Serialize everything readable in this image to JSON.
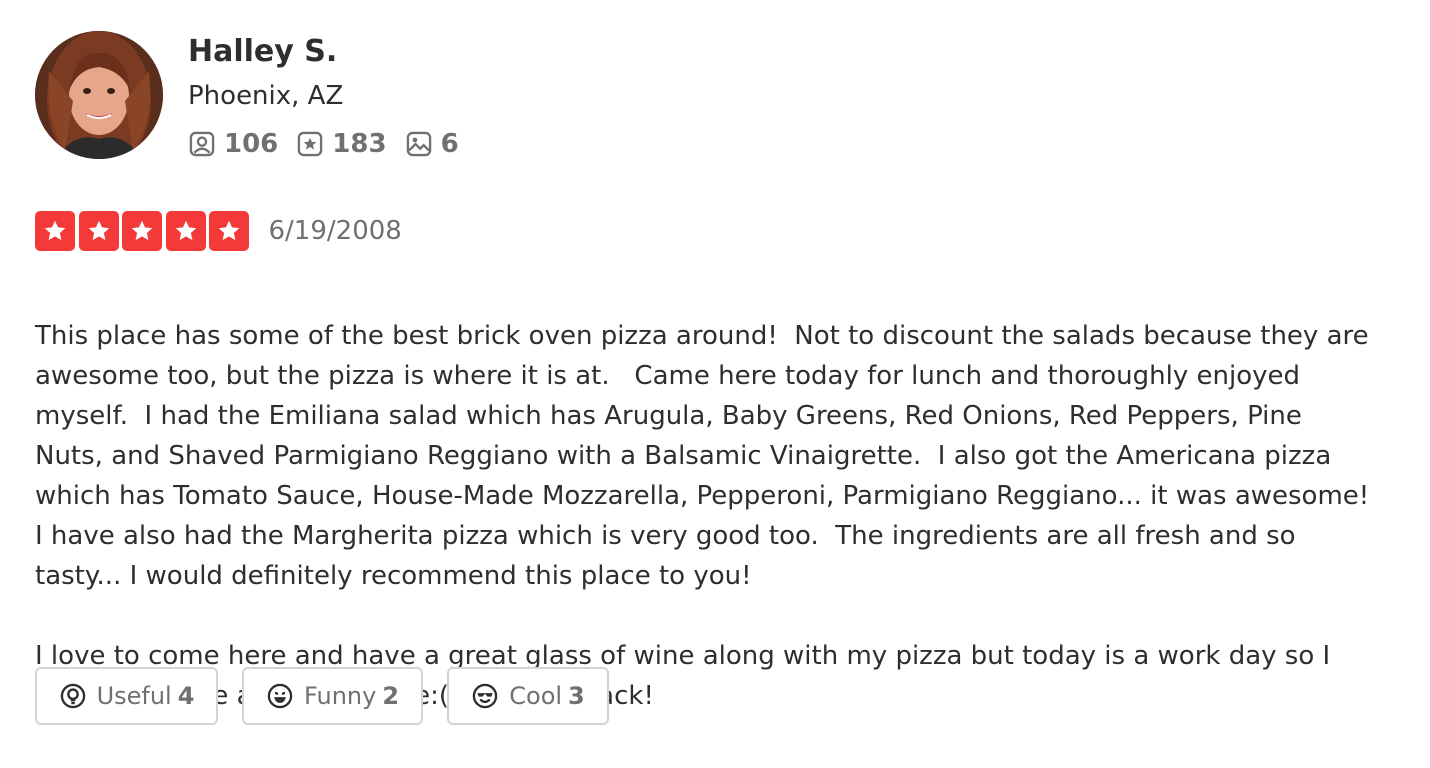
{
  "user": {
    "name": "Halley S.",
    "location": "Phoenix, AZ",
    "stats": {
      "friends": "106",
      "reviews": "183",
      "photos": "6"
    }
  },
  "review": {
    "rating": 5,
    "date": "6/19/2008",
    "paragraphs": [
      "This place has some of the best brick oven pizza around!  Not to discount the salads because they are awesome too, but the pizza is where it is at.   Came here today for lunch and thoroughly enjoyed myself.  I had the Emiliana salad which has Arugula, Baby Greens, Red Onions, Red Peppers, Pine Nuts, and Shaved Parmigiano Reggiano with a Balsamic Vinaigrette.  I also got the Americana pizza which has Tomato Sauce, House-Made Mozzarella, Pepperoni, Parmigiano Reggiano... it was awesome!  I have also had the Margherita pizza which is very good too.  The ingredients are all fresh and so tasty... I would definitely recommend this place to you!",
      "I love to come here and have a great glass of wine along with my pizza but today is a work day so I could not have a glass of wine:(.  I will be back!"
    ]
  },
  "actions": {
    "useful": {
      "label": "Useful",
      "count": "4",
      "icon": "lightbulb-icon"
    },
    "funny": {
      "label": "Funny",
      "count": "2",
      "icon": "smiley-icon"
    },
    "cool": {
      "label": "Cool",
      "count": "3",
      "icon": "sunglasses-face-icon"
    }
  },
  "colors": {
    "star_red": "#f43939",
    "text": "#2d2e2f",
    "muted": "#6e7072",
    "border": "#d4d4d4"
  }
}
